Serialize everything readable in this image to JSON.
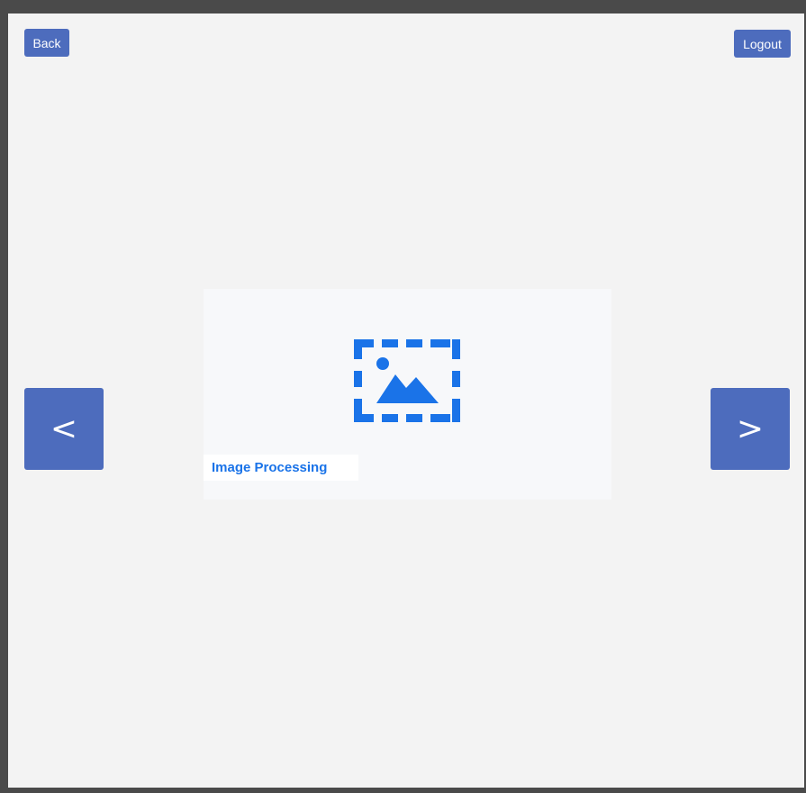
{
  "header": {
    "back_label": "Back",
    "logout_label": "Logout"
  },
  "carousel": {
    "prev_label": "<",
    "next_label": ">",
    "card": {
      "icon": "image-placeholder-icon",
      "label": "Image Processing"
    }
  },
  "colors": {
    "button": "#4d6cbd",
    "accent": "#1a73e8",
    "background": "#f3f3f3",
    "frame": "#4a4a4a"
  }
}
